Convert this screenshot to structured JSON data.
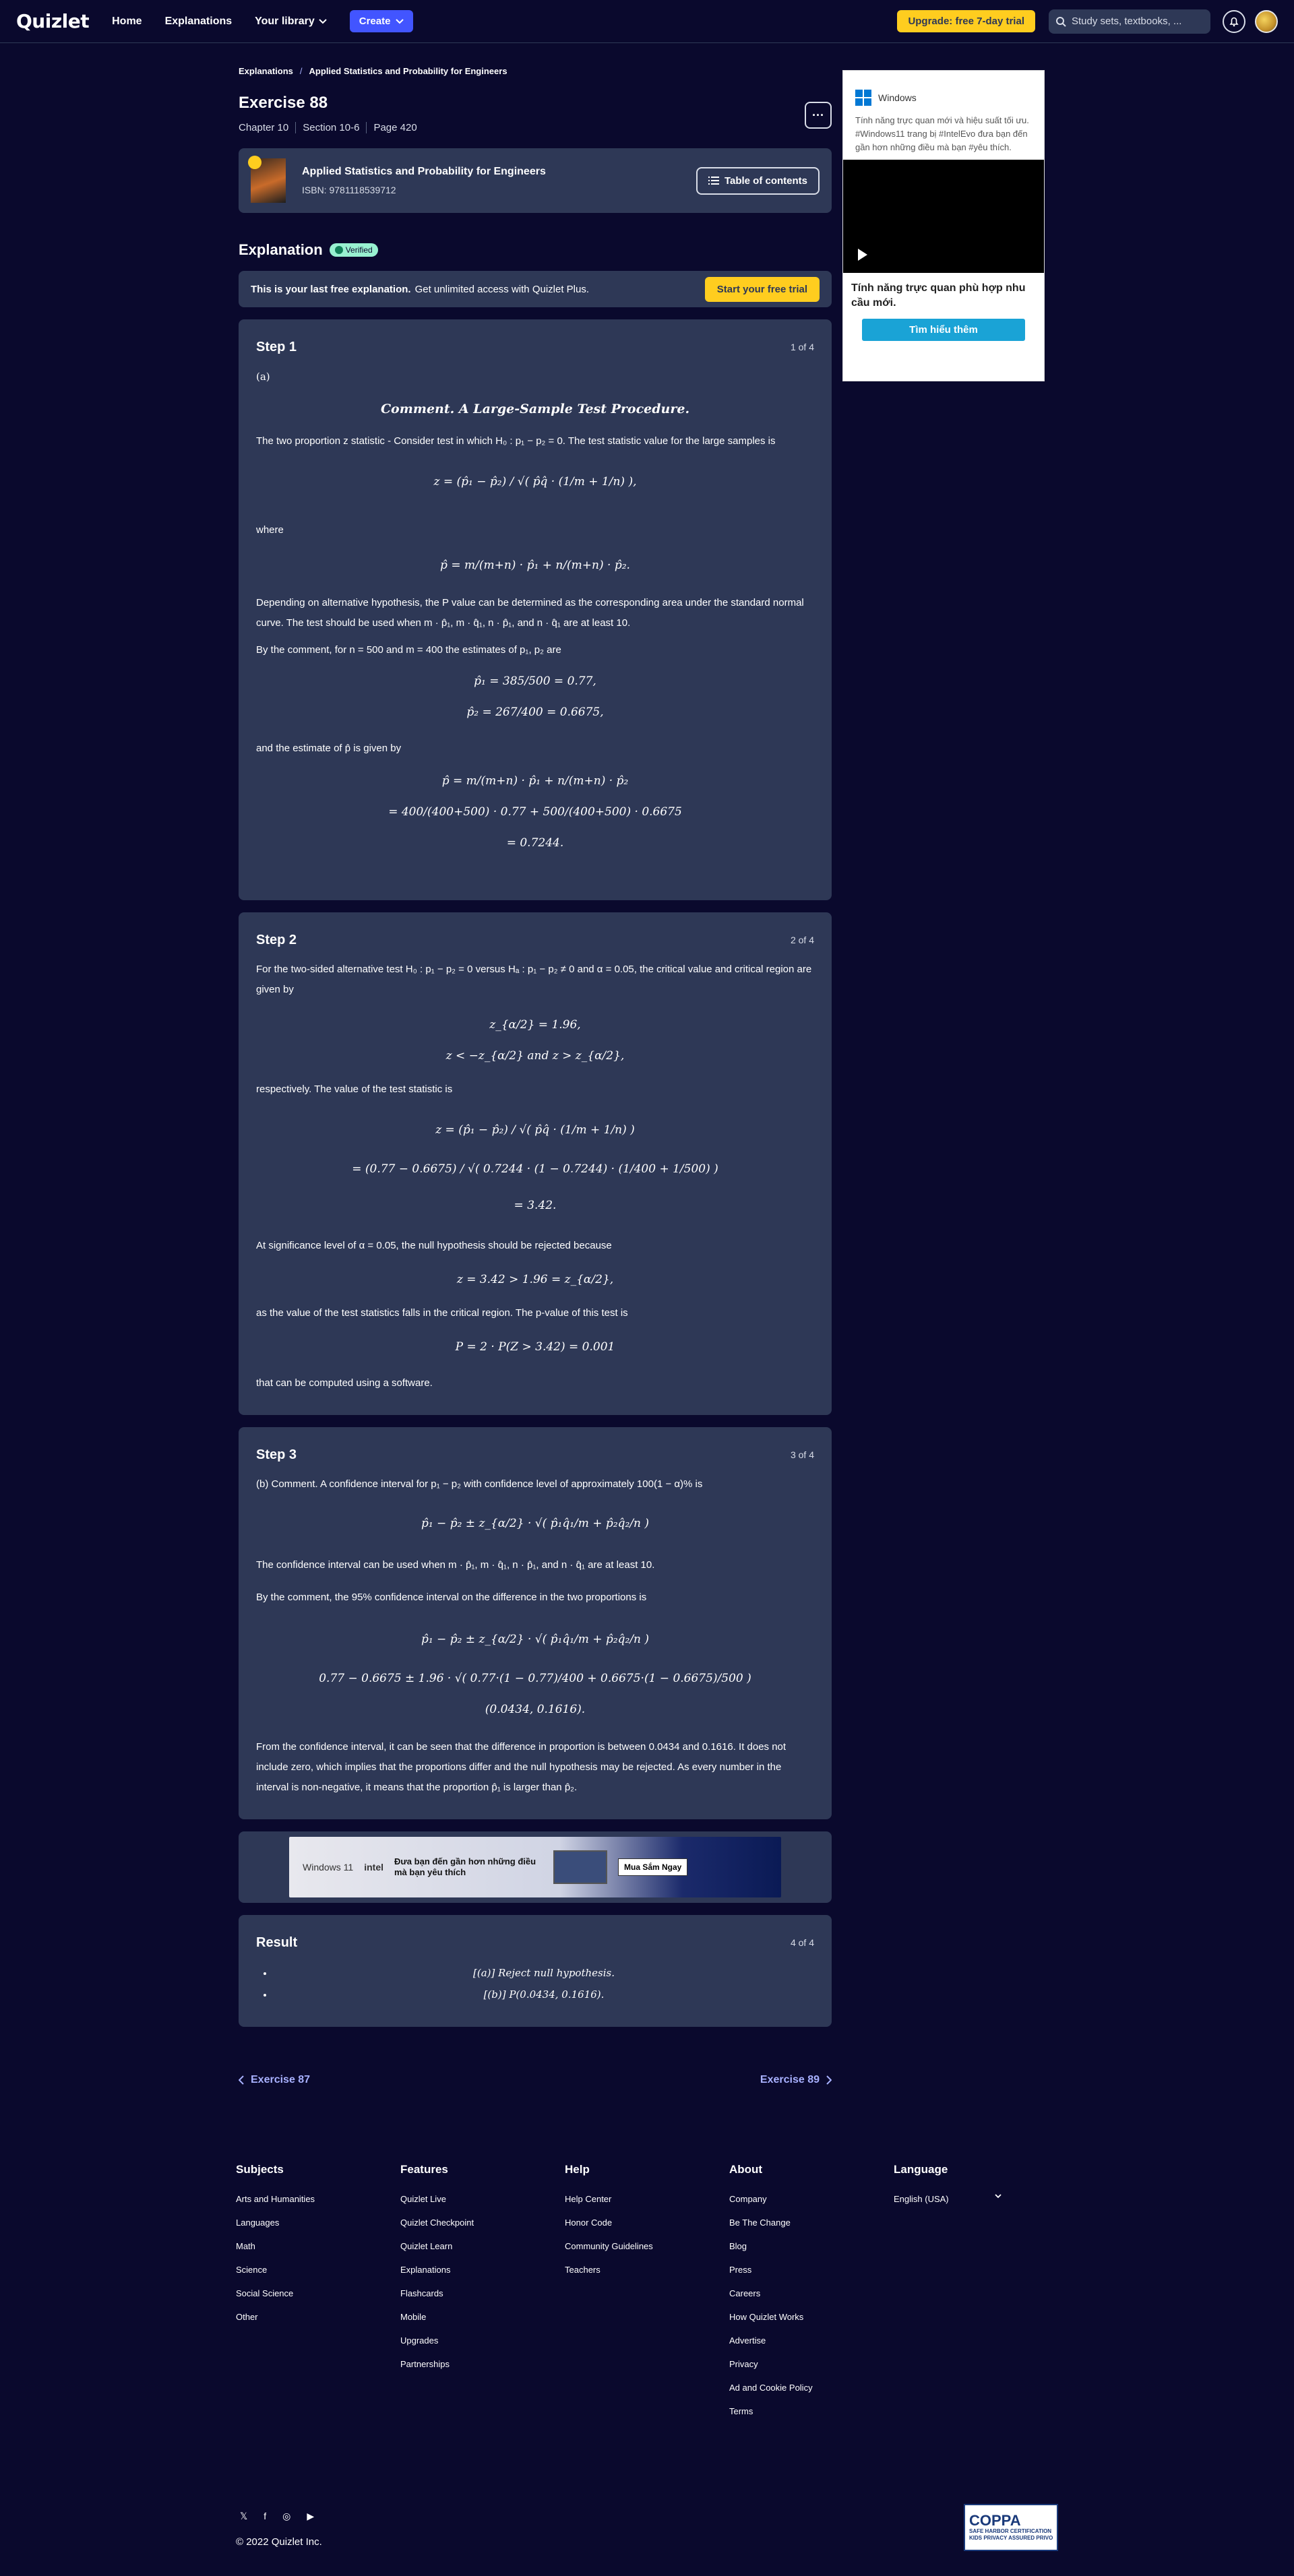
{
  "nav": {
    "logo": "Quizlet",
    "links": [
      "Home",
      "Explanations",
      "Your library"
    ],
    "create": "Create",
    "upgrade": "Upgrade: free 7-day trial",
    "search_placeholder": "Study sets, textbooks, ..."
  },
  "breadcrumb": [
    "Explanations",
    "Applied Statistics and Probability for Engineers"
  ],
  "exercise": {
    "title": "Exercise 88",
    "chapter": "Chapter 10",
    "section": "Section 10-6",
    "page": "Page 420"
  },
  "book": {
    "title": "Applied Statistics and Probability for Engineers",
    "isbn": "ISBN: 9781118539712",
    "toc": "Table of contents"
  },
  "explanation": {
    "heading": "Explanation",
    "verified": "Verified",
    "banner_bold": "This is your last free explanation.",
    "banner_text": "Get unlimited access with Quizlet Plus.",
    "banner_btn": "Start your free trial"
  },
  "step1": {
    "title": "Step 1",
    "count": "1 of 4",
    "label": "(a)",
    "heading": "Comment. A Large-Sample Test Procedure.",
    "p1": "The two proportion z statistic - Consider test in which H₀ : p₁ − p₂ = 0. The test statistic value for the large samples is",
    "eq1": "z = (p̂₁ − p̂₂) / √( p̂q̂ · (1/m + 1/n) ),",
    "where": "where",
    "eq2": "p̂ = m/(m+n) · p̂₁ + n/(m+n) · p̂₂.",
    "p2": "Depending on alternative hypothesis, the P value can be determined as the corresponding area under the standard normal curve. The test should be used when m · p̂₁, m · q̂₁, n · p̂₁, and n · q̂₁ are at least 10.",
    "p3": "By the comment, for n = 500 and m = 400 the estimates of p₁, p₂ are",
    "eq3a": "p̂₁ = 385/500 = 0.77,",
    "eq3b": "p̂₂ = 267/400 = 0.6675,",
    "p4": "and the estimate of p̂ is given by",
    "eq4a": "p̂ = m/(m+n) · p̂₁ + n/(m+n) · p̂₂",
    "eq4b": "= 400/(400+500) · 0.77 + 500/(400+500) · 0.6675",
    "eq4c": "= 0.7244."
  },
  "step2": {
    "title": "Step 2",
    "count": "2 of 4",
    "p1": "For the two-sided alternative test H₀ : p₁ − p₂ = 0 versus Hₐ : p₁ − p₂ ≠ 0 and α = 0.05, the critical value and critical region are given by",
    "eq1a": "z_{α/2} = 1.96,",
    "eq1b": "z < −z_{α/2} and z > z_{α/2},",
    "p2": "respectively. The value of the test statistic is",
    "eq2a": "z = (p̂₁ − p̂₂) / √( p̂q̂ · (1/m + 1/n) )",
    "eq2b": "= (0.77 − 0.6675) / √( 0.7244 · (1 − 0.7244) · (1/400 + 1/500) )",
    "eq2c": "= 3.42.",
    "p3": "At significance level of α = 0.05, the null hypothesis should be rejected because",
    "eq3": "z = 3.42 > 1.96 = z_{α/2},",
    "p4": "as the value of the test statistics falls in the critical region. The p-value of this test is",
    "eq4": "P = 2 · P(Z > 3.42) = 0.001",
    "p5": "that can be computed using a software."
  },
  "step3": {
    "title": "Step 3",
    "count": "3 of 4",
    "p1": "(b) Comment. A confidence interval for p₁ − p₂ with confidence level of approximately 100(1 − α)% is",
    "eq1": "p̂₁ − p̂₂ ± z_{α/2} · √( p̂₁q̂₁/m + p̂₂q̂₂/n )",
    "p2": "The confidence interval can be used when m · p̂₁, m · q̂₁, n · p̂₁, and n · q̂₁ are at least 10.",
    "p3": "By the comment, the 95% confidence interval on the difference in the two proportions is",
    "eq2a": "p̂₁ − p̂₂ ± z_{α/2} · √( p̂₁q̂₁/m + p̂₂q̂₂/n )",
    "eq2b": "0.77 − 0.6675 ± 1.96 · √( 0.77·(1 − 0.77)/400 + 0.6675·(1 − 0.6675)/500 )",
    "eq2c": "(0.0434, 0.1616).",
    "p4": "From the confidence interval, it can be seen that the difference in proportion is between 0.0434 and 0.1616. It does not include zero, which implies that the proportions differ and the null hypothesis may be rejected. As every number in the interval is non-negative, it means that the proportion p̂₁ is larger than p̂₂."
  },
  "ad_banner": {
    "brand1": "Windows 11",
    "brand2": "intel",
    "text": "Đưa bạn đến gần hơn những điều mà bạn yêu thích",
    "btn": "Mua Sắm Ngay"
  },
  "result": {
    "title": "Result",
    "count": "4 of 4",
    "items": [
      "[(a)] Reject null hypothesis.",
      "[(b)] P(0.0434, 0.1616)."
    ]
  },
  "pager": {
    "prev": "Exercise 87",
    "next": "Exercise 89"
  },
  "side_ad": {
    "brand": "Windows",
    "body": "Tính năng trực quan mới và hiệu suất tối ưu. #Windows11 trang bị #IntelEvo đưa bạn đến gần hơn những điều mà bạn #yêu thích.",
    "tagline": "Tính năng trực quan phù hợp nhu cầu mới.",
    "cta": "Tìm hiểu thêm"
  },
  "footer": {
    "columns": [
      {
        "title": "Subjects",
        "links": [
          "Arts and Humanities",
          "Languages",
          "Math",
          "Science",
          "Social Science",
          "Other"
        ]
      },
      {
        "title": "Features",
        "links": [
          "Quizlet Live",
          "Quizlet Checkpoint",
          "Quizlet Learn",
          "Explanations",
          "Flashcards",
          "Mobile",
          "Upgrades",
          "Partnerships"
        ]
      },
      {
        "title": "Help",
        "links": [
          "Help Center",
          "Honor Code",
          "Community Guidelines",
          "Teachers"
        ]
      },
      {
        "title": "About",
        "links": [
          "Company",
          "Be The Change",
          "Blog",
          "Press",
          "Careers",
          "How Quizlet Works",
          "Advertise",
          "Privacy",
          "Ad and Cookie Policy",
          "Terms"
        ]
      }
    ],
    "language_title": "Language",
    "language_value": "English (USA)",
    "copyright": "© 2022 Quizlet Inc.",
    "coppa": "COPPA",
    "coppa_sub": "SAFE HARBOR CERTIFICATION",
    "coppa_side": "KIDS PRIVACY ASSURED PRIVO"
  }
}
